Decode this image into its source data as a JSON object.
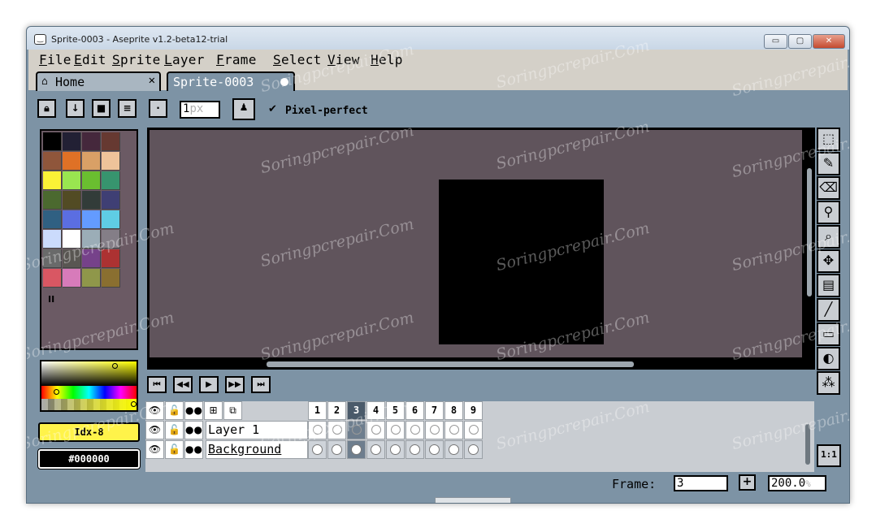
{
  "window": {
    "title": "Sprite-0003 - Aseprite v1.2-beta12-trial",
    "app_icon": "aseprite-face-icon",
    "minimize": "▭",
    "maximize": "▢",
    "close": "✕"
  },
  "menu": [
    "File",
    "Edit",
    "Sprite",
    "Layer",
    "Frame",
    "Select",
    "View",
    "Help"
  ],
  "tabs": {
    "home": {
      "label": "Home",
      "close": "✕"
    },
    "sprite": {
      "label": "Sprite-0003"
    }
  },
  "context_bar": {
    "brush_size": "1",
    "brush_unit": "px",
    "pixel_perfect_label": "Pixel-perfect",
    "pixel_perfect_checked": true
  },
  "palette": {
    "colors": [
      "#000000",
      "#222034",
      "#45283c",
      "#663931",
      "#8f563b",
      "#df7126",
      "#d9a066",
      "#eec39a",
      "#fbf236",
      "#99e550",
      "#6abe30",
      "#37946e",
      "#4b692f",
      "#524b24",
      "#323c39",
      "#3f3f74",
      "#306082",
      "#5b6ee1",
      "#639bff",
      "#5fcde4",
      "#cbdbfc",
      "#ffffff",
      "#9badb7",
      "#847e87",
      "#696a6a",
      "#595652",
      "#76428a",
      "#ac3232",
      "#d95763",
      "#d77bba",
      "#8f974a",
      "#8a6f30"
    ],
    "pin_label": "II"
  },
  "colors": {
    "foreground_label": "Idx-8",
    "foreground_hex": "#fff34a",
    "background_label": "#000000",
    "background_hex": "#000000"
  },
  "tools": [
    {
      "name": "rectangular-marquee-icon",
      "glyph": "⬚"
    },
    {
      "name": "pencil-icon",
      "glyph": "✎"
    },
    {
      "name": "eraser-icon",
      "glyph": "⌫"
    },
    {
      "name": "eyedropper-icon",
      "glyph": "⚲"
    },
    {
      "name": "zoom-icon",
      "glyph": "⌕"
    },
    {
      "name": "move-icon",
      "glyph": "✥"
    },
    {
      "name": "gradient-fill-icon",
      "glyph": "▤"
    },
    {
      "name": "line-icon",
      "glyph": "╱"
    },
    {
      "name": "rectangle-icon",
      "glyph": "▭"
    },
    {
      "name": "contour-icon",
      "glyph": "◐"
    },
    {
      "name": "blur-icon",
      "glyph": "⁂"
    }
  ],
  "playback": [
    "⏮",
    "◀◀",
    "▶",
    "▶▶",
    "⏭"
  ],
  "timeline": {
    "header_icons": [
      "👁",
      "🔓",
      "●●",
      "⊞",
      "⧉"
    ],
    "frames": [
      "1",
      "2",
      "3",
      "4",
      "5",
      "6",
      "7",
      "8",
      "9"
    ],
    "layers": [
      {
        "name": "Layer 1",
        "eye": "👁",
        "lock": "🔓",
        "link": "●●"
      },
      {
        "name": "Background",
        "eye": "👁",
        "lock": "🔓",
        "link": "●●"
      }
    ]
  },
  "status": {
    "frame_label": "Frame:",
    "frame_value": "3",
    "add_frame": "+",
    "zoom_value": "200.0",
    "zoom_unit": "%",
    "zoom_reset": "1:1"
  },
  "watermark": "Soringpcrepair.Com"
}
